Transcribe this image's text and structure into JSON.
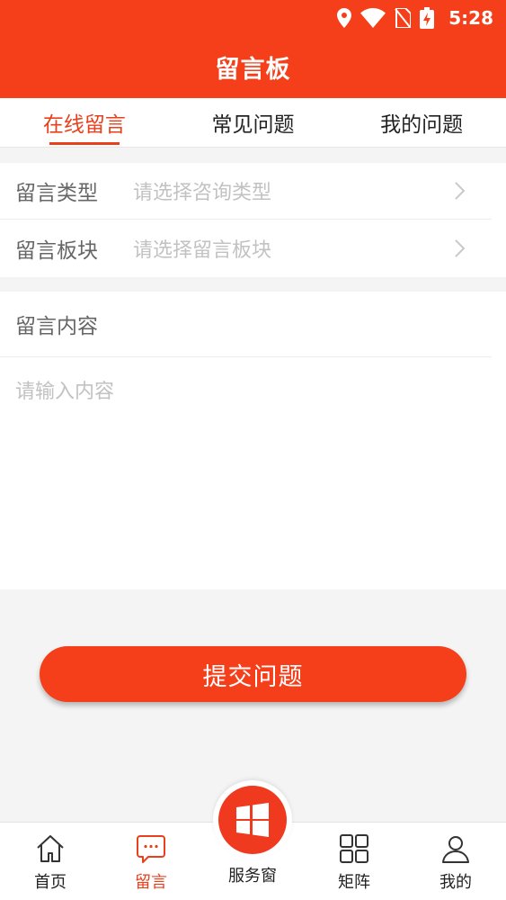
{
  "status_bar": {
    "time": "5:28"
  },
  "header": {
    "title": "留言板"
  },
  "tabs": [
    {
      "label": "在线留言",
      "active": true
    },
    {
      "label": "常见问题",
      "active": false
    },
    {
      "label": "我的问题",
      "active": false
    }
  ],
  "form": {
    "type_label": "留言类型",
    "type_placeholder": "请选择咨询类型",
    "board_label": "留言板块",
    "board_placeholder": "请选择留言板块",
    "content_label": "留言内容",
    "content_placeholder": "请输入内容"
  },
  "submit_label": "提交问题",
  "bottom_nav": {
    "home": "首页",
    "message": "留言",
    "service": "服务窗",
    "matrix": "矩阵",
    "mine": "我的"
  },
  "colors": {
    "brand": "#f43f1a",
    "active_text": "#e8401c"
  },
  "icons": {
    "home": "home-icon",
    "message": "chat-bubble-icon",
    "service": "windows-logo-icon",
    "matrix": "grid-icon",
    "mine": "user-icon"
  }
}
